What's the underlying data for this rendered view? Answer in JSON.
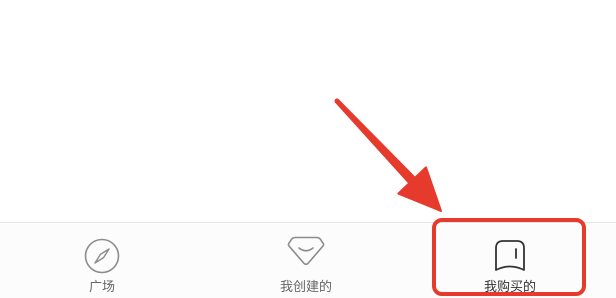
{
  "tab_bar": {
    "tabs": [
      {
        "label": "广场",
        "icon": "compass-icon",
        "active": false
      },
      {
        "label": "我创建的",
        "icon": "gem-icon",
        "active": false
      },
      {
        "label": "我购买的",
        "icon": "bookmark-icon",
        "active": true
      }
    ]
  },
  "colors": {
    "label_default": "#666666",
    "label_active": "#333333",
    "icon_default": "#8c8c8c",
    "icon_active": "#333333",
    "divider": "#e6e6e6",
    "annotation": "#e53a2c"
  }
}
